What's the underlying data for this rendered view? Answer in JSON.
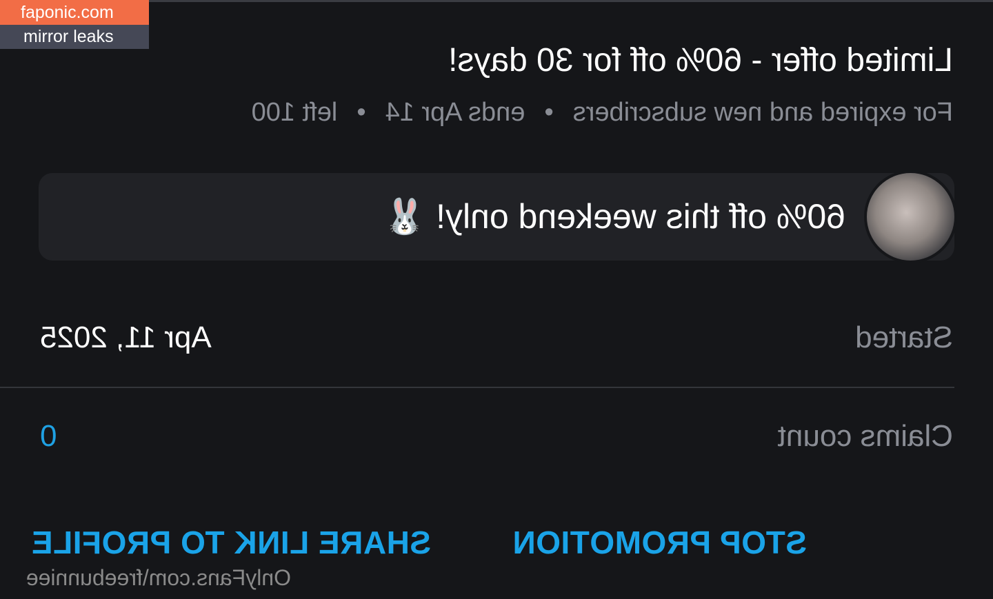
{
  "watermark": {
    "site": "faponic.com",
    "tagline": "mirror leaks",
    "profile_url": "OnlyFans.com\\freebunniee"
  },
  "offer": {
    "title": "Limited offer - 60% off for 30 days!",
    "audience": "For expired and new subscribers",
    "ends": "ends Apr 14",
    "left": "left 100",
    "separator": "•"
  },
  "message": {
    "text": "60% off this weekend only!",
    "emoji": "🐰"
  },
  "details": {
    "started_label": "Started",
    "started_value": "Apr 11, 2025",
    "claims_label": "Claims count",
    "claims_value": "0"
  },
  "actions": {
    "stop_label": "STOP PROMOTION",
    "share_label": "SHARE LINK TO PROFILE"
  },
  "colors": {
    "background": "#151619",
    "accent": "#1aa3e8",
    "muted_text": "#8a8d95",
    "badge_orange": "#f26d46"
  }
}
